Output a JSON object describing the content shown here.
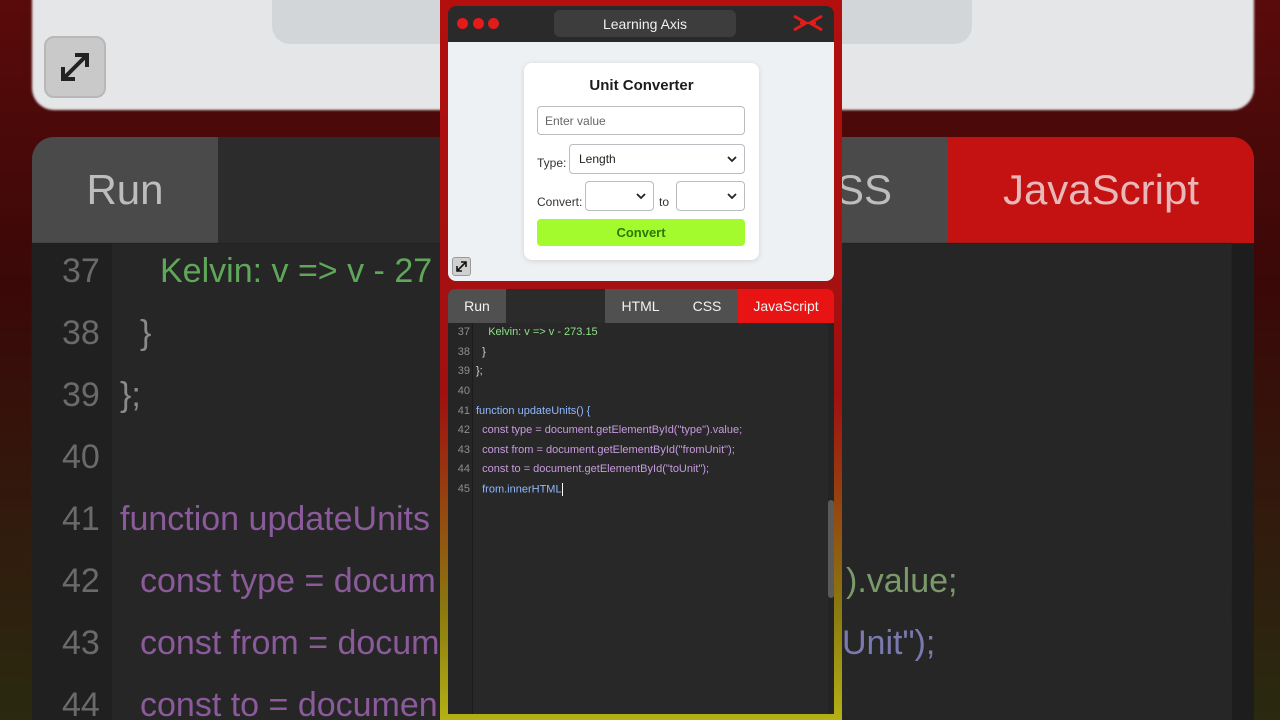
{
  "window": {
    "title": "Learning Axis"
  },
  "converter": {
    "heading": "Unit Converter",
    "value_placeholder": "Enter value",
    "type_label": "Type:",
    "type_selected": "Length",
    "convert_label": "Convert:",
    "from_selected": "",
    "to_word": "to",
    "to_selected": "",
    "button_label": "Convert"
  },
  "tabs": {
    "run": "Run",
    "html": "HTML",
    "css": "CSS",
    "javascript": "JavaScript",
    "active": "JavaScript"
  },
  "editor": {
    "line_numbers": [
      "37",
      "38",
      "39",
      "40",
      "41",
      "42",
      "43",
      "44",
      "45"
    ],
    "lines": [
      "    Kelvin: v => v - 273.15",
      "  }",
      "};",
      "",
      "function updateUnits() {",
      "  const type = document.getElementById(\"type\").value;",
      "  const from = document.getElementById(\"fromUnit\");",
      "  const to = document.getElementById(\"toUnit\");",
      "  from.innerHTML"
    ]
  },
  "background": {
    "run": "Run",
    "css": "SS",
    "javascript": "JavaScript",
    "line_numbers": [
      "37",
      "38",
      "39",
      "40",
      "41",
      "42",
      "43",
      "44"
    ],
    "lines": [
      "Kelvin: v => v - 27",
      "}",
      "};",
      "",
      "function updateUnits",
      "const type = docum",
      "const from = docum",
      "const to = documen"
    ],
    "right_fragments": [
      ").value;",
      "Unit\");"
    ]
  },
  "colors": {
    "accent_red": "#e21b1b",
    "convert_green": "#a3fb2e",
    "keyword": "#d977e6",
    "identifier": "#8fb8ff",
    "method": "#8fe08a",
    "string": "#a7a2ff"
  },
  "icons": [
    "traffic-dot-icon",
    "brand-logo-icon",
    "chevron-down-icon",
    "expand-icon"
  ]
}
